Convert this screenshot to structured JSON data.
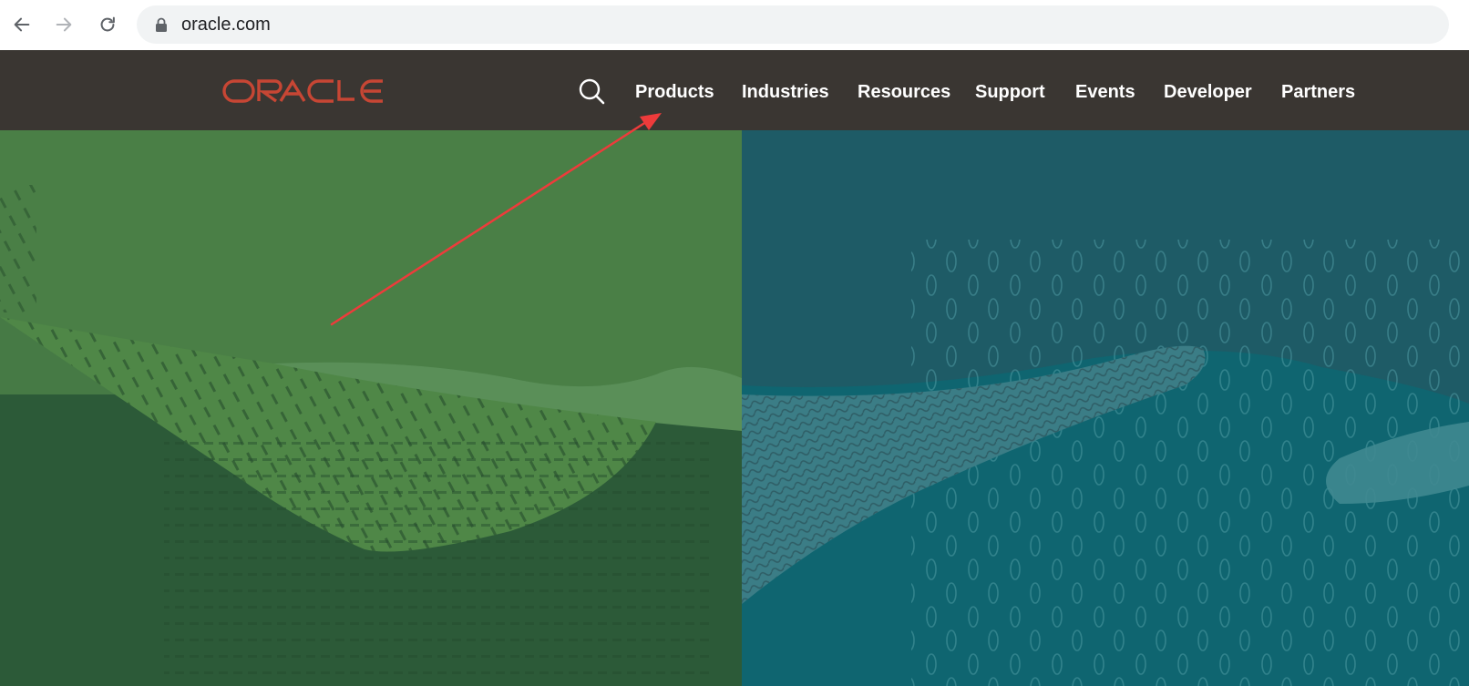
{
  "browser": {
    "back_icon": "arrow-left-icon",
    "forward_icon": "arrow-right-icon",
    "reload_icon": "reload-icon",
    "lock_icon": "lock-icon",
    "url": "oracle.com"
  },
  "header": {
    "logo_text": "ORACLE",
    "brand_color": "#c74634",
    "background": "#3a3632",
    "search_icon": "search-icon",
    "nav": [
      {
        "label": "Products"
      },
      {
        "label": "Industries"
      },
      {
        "label": "Resources"
      },
      {
        "label": "Support"
      },
      {
        "label": "Events"
      },
      {
        "label": "Developer"
      },
      {
        "label": "Partners"
      }
    ]
  },
  "hero": {
    "left_color": "#2f5e3b",
    "right_color": "#1d5a64"
  },
  "annotation": {
    "arrow_color": "#ee3b3b",
    "target": "Products"
  }
}
